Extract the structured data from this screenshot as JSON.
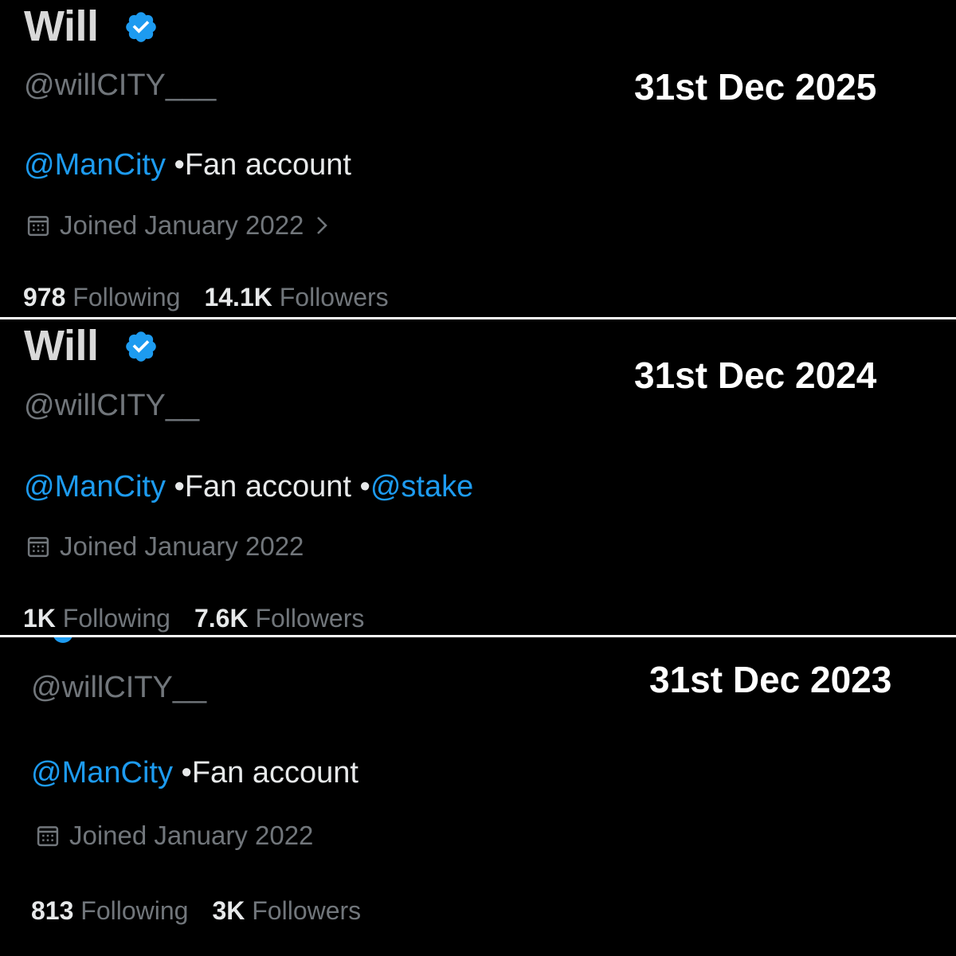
{
  "snapshots": [
    {
      "date_label": "31st Dec 2025",
      "name": "Will",
      "handle": "@willCITY___",
      "bio": {
        "mention1": "@ManCity",
        "text": " •Fan account",
        "mention2": null
      },
      "joined": "Joined January 2022",
      "following_count": "978",
      "following_label": "Following",
      "followers_count": "14.1K",
      "followers_label": "Followers"
    },
    {
      "date_label": "31st Dec 2024",
      "name": "Will",
      "handle": "@willCITY__",
      "bio": {
        "mention1": "@ManCity",
        "text": " •Fan account •",
        "mention2": "@stake"
      },
      "joined": "Joined January 2022",
      "following_count": "1K",
      "following_label": "Following",
      "followers_count": "7.6K",
      "followers_label": "Followers"
    },
    {
      "date_label": "31st Dec 2023",
      "handle": "@willCITY__",
      "bio": {
        "mention1": "@ManCity",
        "text": " •Fan account",
        "mention2": null
      },
      "joined": "Joined January 2022",
      "following_count": "813",
      "following_label": "Following",
      "followers_count": "3K",
      "followers_label": "Followers"
    }
  ],
  "icons": {
    "verified": "verified-badge-icon",
    "calendar": "calendar-icon",
    "chevron": "chevron-right-icon"
  },
  "colors": {
    "background": "#000000",
    "accent_blue": "#1d9bf0",
    "muted_gray": "#71767b",
    "divider": "#ffffff"
  }
}
